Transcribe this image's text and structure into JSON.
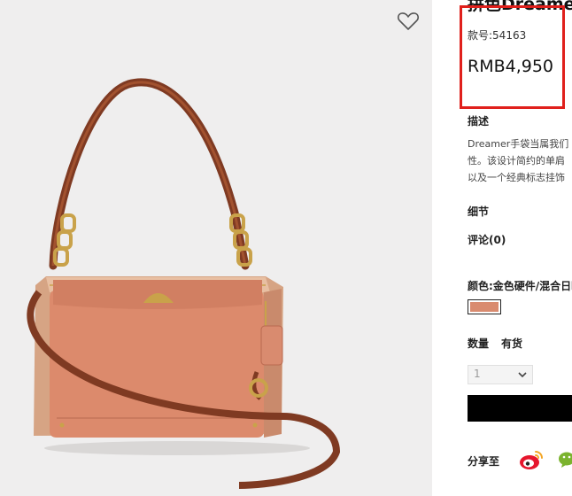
{
  "product": {
    "title": "拼色Dreamer",
    "sku": "款号:54163",
    "price": "RMB4,950"
  },
  "sections": {
    "description_heading": "描述",
    "description_lines": [
      "Dreamer手袋当属我们",
      "性。该设计简约的单肩",
      "以及一个经典标志挂饰"
    ],
    "details_heading": "细节",
    "reviews_heading": "评论(0)",
    "color_label": "颜色:金色硬件/混合日晒"
  },
  "color_swatch": {
    "color": "#d98b6f"
  },
  "quantity": {
    "label": "数量",
    "stock": "有货",
    "selected": "1"
  },
  "share": {
    "label": "分享至"
  },
  "icons": [
    "heart-icon",
    "chevron-down-icon",
    "weibo-icon",
    "wechat-icon"
  ],
  "colors": {
    "highlight": "#e0201c",
    "bag": "#d98b6f",
    "strap": "#8b3a22",
    "hardware": "#c9a24a"
  }
}
